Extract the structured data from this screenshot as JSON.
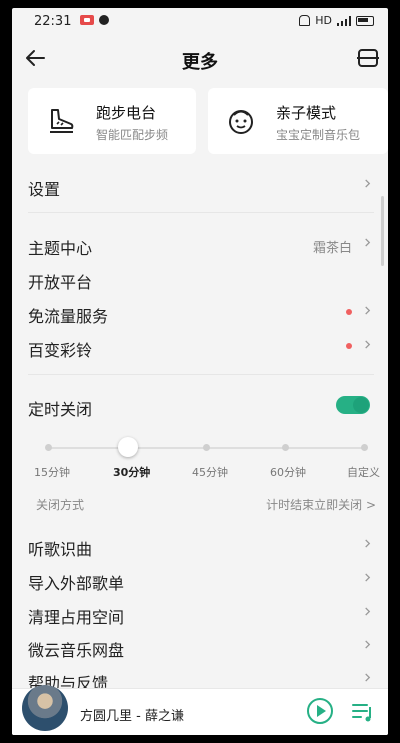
{
  "status": {
    "time": "22:31",
    "network": "HD"
  },
  "header": {
    "title": "更多"
  },
  "cards": [
    {
      "title": "跑步电台",
      "subtitle": "智能匹配步频"
    },
    {
      "title": "亲子模式",
      "subtitle": "宝宝定制音乐包"
    }
  ],
  "rows": {
    "settings": "设置",
    "theme": "主题中心",
    "theme_value": "霜茶白",
    "open_platform": "开放平台",
    "free_traffic": "免流量服务",
    "ringtone": "百变彩铃",
    "timer": "定时关闭",
    "recognize": "听歌识曲",
    "import": "导入外部歌单",
    "clean": "清理占用空间",
    "weiyun": "微云音乐网盘",
    "help": "帮助与反馈"
  },
  "timer": {
    "enabled": true,
    "options": [
      "15分钟",
      "30分钟",
      "45分钟",
      "60分钟",
      "自定义"
    ],
    "selected_index": 1,
    "close_mode_label": "关闭方式",
    "close_mode_value": "计时结束立即关闭 >"
  },
  "player": {
    "song": "方圆几里 - 薛之谦"
  },
  "colors": {
    "accent": "#26b085",
    "badge": "#f06060"
  }
}
